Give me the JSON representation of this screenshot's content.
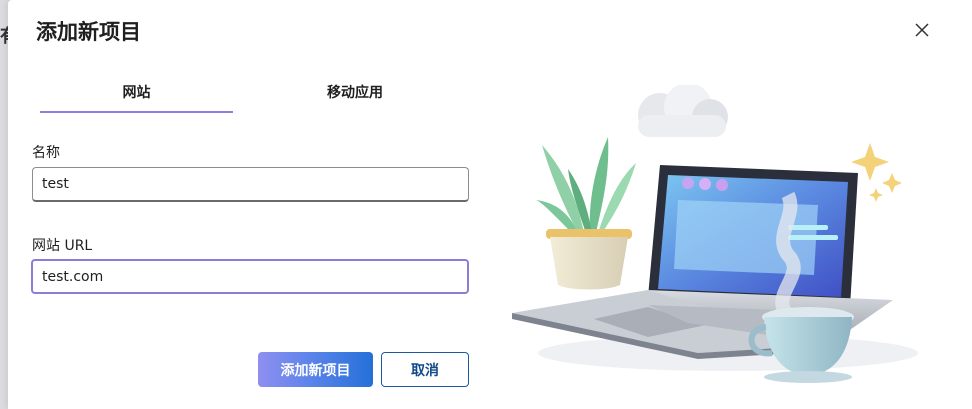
{
  "background": {
    "glyph": "有"
  },
  "dialog": {
    "title": "添加新项目",
    "close_icon": "close-icon"
  },
  "tabs": [
    {
      "label": "网站",
      "selected": true
    },
    {
      "label": "移动应用",
      "selected": false
    }
  ],
  "form": {
    "name": {
      "label": "名称",
      "value": "test"
    },
    "url": {
      "label": "网站 URL",
      "value": "test.com"
    }
  },
  "buttons": {
    "add_label": "添加新项目",
    "cancel_label": "取消"
  },
  "colors": {
    "accent": "#8b80e0",
    "primary_start": "#8f8ff0",
    "primary_end": "#2470d8",
    "cancel_text": "#114a8b"
  }
}
